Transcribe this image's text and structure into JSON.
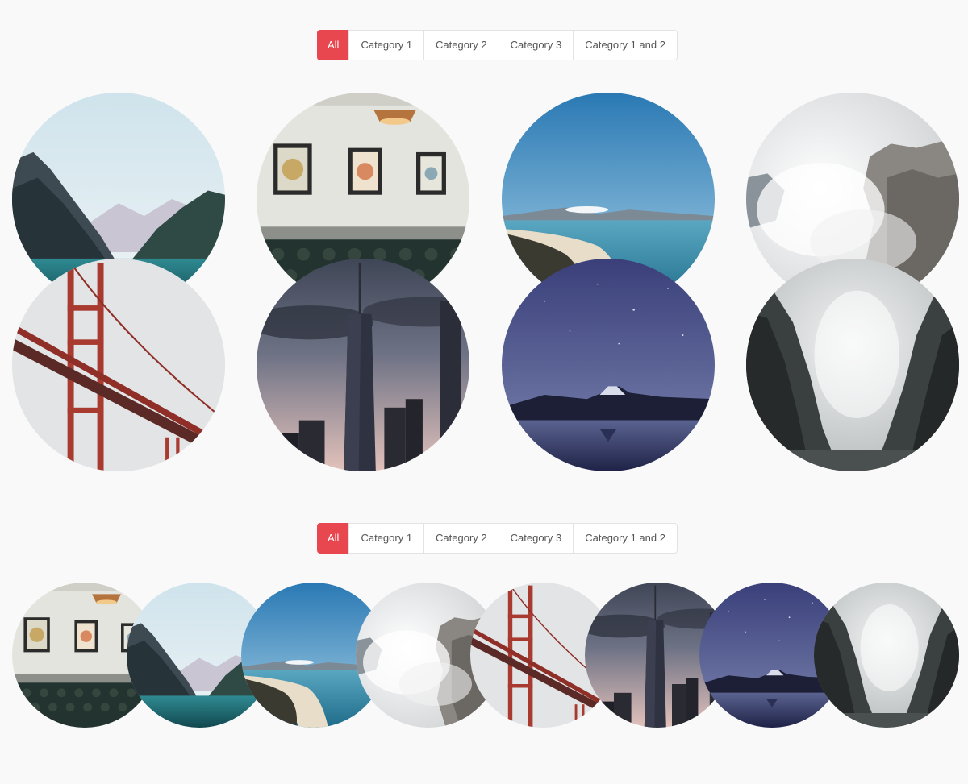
{
  "filters_top": {
    "buttons": [
      "All",
      "Category 1",
      "Category 2",
      "Category 3",
      "Category 1 and 2"
    ],
    "active": "All"
  },
  "filters_bottom": {
    "buttons": [
      "All",
      "Category 1",
      "Category 2",
      "Category 3",
      "Category 1 and 2"
    ],
    "active": "All"
  },
  "colors": {
    "accent": "#e8474f",
    "background": "#f9f9f9",
    "button_bg": "#ffffff",
    "button_border": "#e3e3e3",
    "button_text": "#555555"
  },
  "gallery_top": [
    {
      "scene": "mountain-lake"
    },
    {
      "scene": "cafe-interior"
    },
    {
      "scene": "coastline"
    },
    {
      "scene": "misty-cliff"
    },
    {
      "scene": "golden-gate-bridge"
    },
    {
      "scene": "skyscraper"
    },
    {
      "scene": "starry-mountain"
    },
    {
      "scene": "foggy-canyon"
    }
  ],
  "gallery_bottom": [
    {
      "scene": "cafe-interior"
    },
    {
      "scene": "mountain-lake"
    },
    {
      "scene": "coastline"
    },
    {
      "scene": "misty-cliff"
    },
    {
      "scene": "golden-gate-bridge"
    },
    {
      "scene": "skyscraper"
    },
    {
      "scene": "starry-mountain"
    },
    {
      "scene": "foggy-canyon"
    }
  ]
}
